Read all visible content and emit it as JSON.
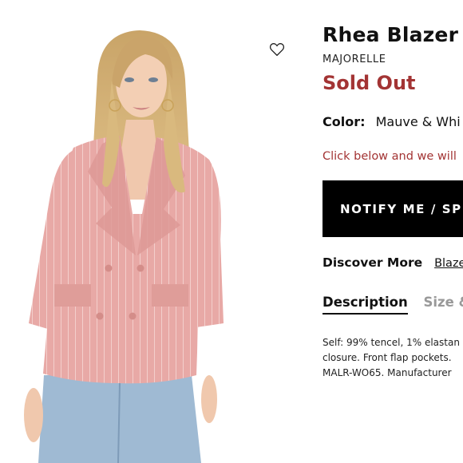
{
  "product": {
    "title": "Rhea Blazer",
    "brand": "MAJORELLE",
    "status": "Sold Out",
    "color_label": "Color:",
    "color_value": "Mauve & Whi",
    "notify_text": "Click below and we will",
    "notify_button": "NOTIFY ME / SP",
    "discover_label": "Discover More",
    "discover_link": "Blazer",
    "tabs": [
      {
        "label": "Description",
        "active": true
      },
      {
        "label": "Size &",
        "active": false
      }
    ],
    "description_lines": [
      "Self: 99% tencel, 1% elastan",
      "closure. Front flap pockets.",
      "MALR-WO65. Manufacturer"
    ]
  },
  "image": {
    "subject": "model wearing pink pinstripe double-breasted blazer"
  },
  "icons": {
    "wishlist": "heart-outline-icon"
  },
  "colors": {
    "accent_red": "#a33434",
    "button_bg": "#000000",
    "blazer_pink": "#e6a7a5"
  }
}
